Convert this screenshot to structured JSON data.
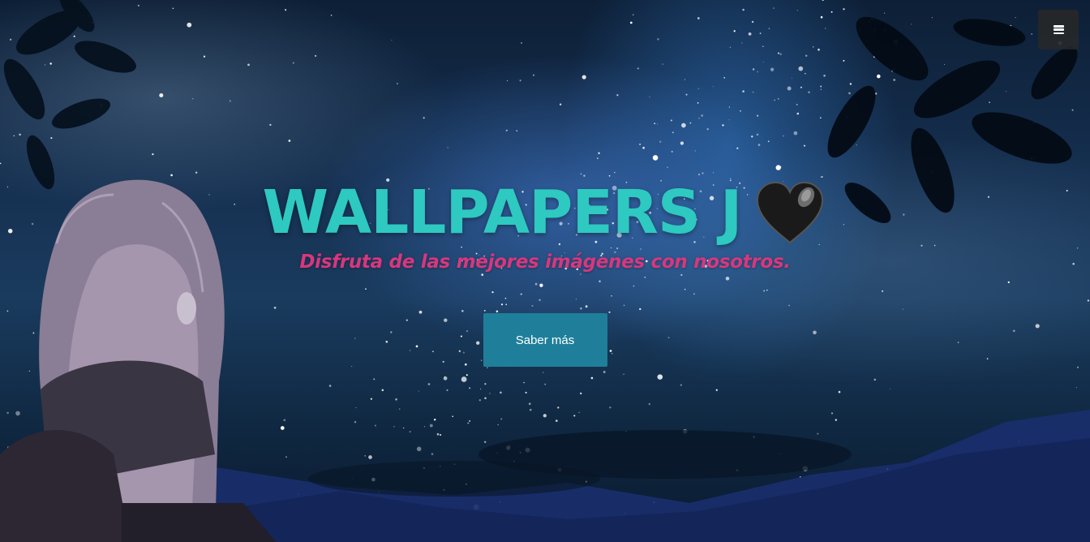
{
  "nav": {
    "menu_icon": "hamburger-menu-icon"
  },
  "hero": {
    "title": "WALLPAPERS J",
    "title_icon": "black-heart-icon",
    "subtitle": "Disfruta de las mejores imágenes con nosotros.",
    "cta_label": "Saber más"
  },
  "colors": {
    "title": "#2ec9c0",
    "subtitle": "#d8377d",
    "button": "#1f7f9a",
    "menu_button": "#282828"
  }
}
